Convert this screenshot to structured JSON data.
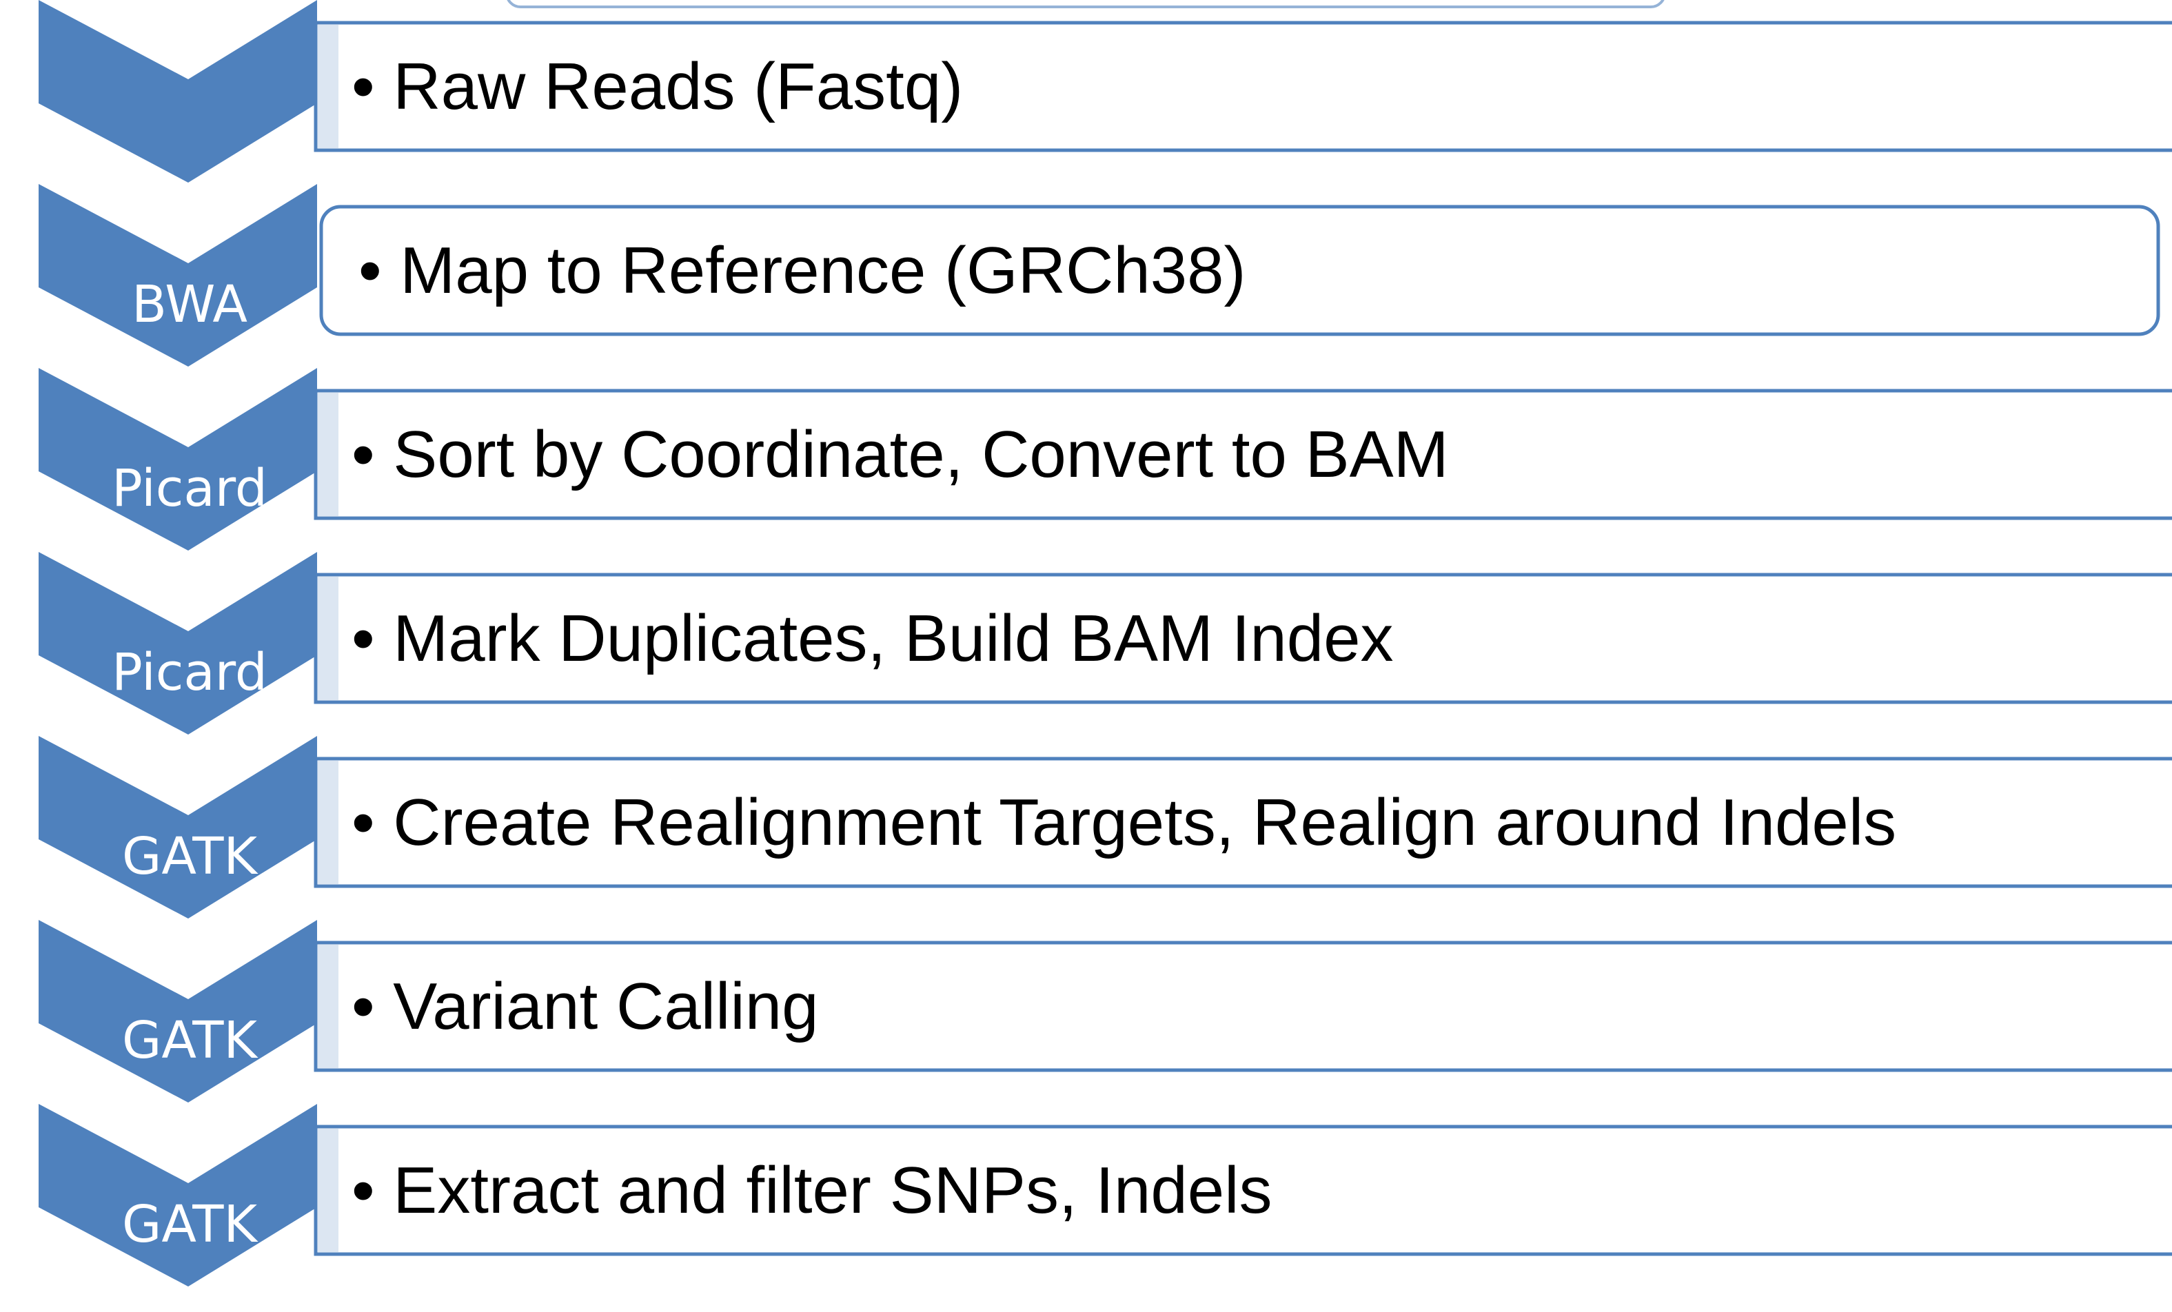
{
  "colors": {
    "chevron": "#4f81bd",
    "box_border": "#4f81bd",
    "box_shade": "#dce6f2",
    "chevron_text": "#ffffff",
    "box_text": "#000000"
  },
  "steps": [
    {
      "tool": "",
      "text": "• Raw Reads (Fastq)"
    },
    {
      "tool": "BWA",
      "text": "• Map to Reference (GRCh38)"
    },
    {
      "tool": "Picard",
      "text": "• Sort by Coordinate, Convert to BAM"
    },
    {
      "tool": "Picard",
      "text": "• Mark Duplicates, Build BAM Index"
    },
    {
      "tool": "GATK",
      "text": "• Create Realignment Targets, Realign around Indels"
    },
    {
      "tool": "GATK",
      "text": "• Variant Calling"
    },
    {
      "tool": "GATK",
      "text": "• Extract and filter SNPs, Indels"
    }
  ]
}
